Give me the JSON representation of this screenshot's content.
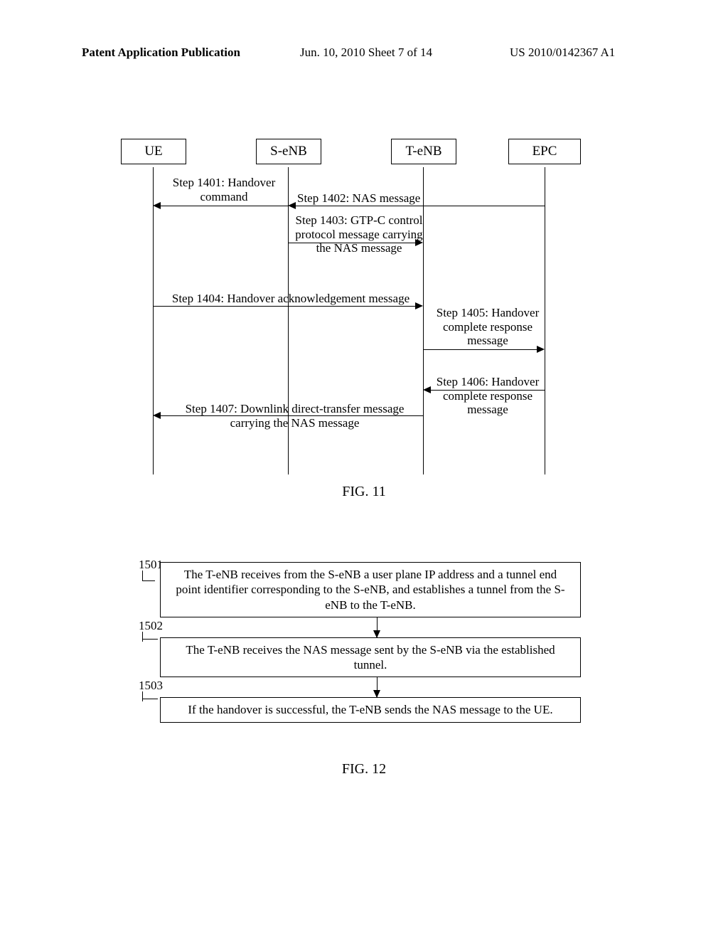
{
  "header": {
    "left": "Patent Application Publication",
    "mid": "Jun. 10, 2010  Sheet 7 of 14",
    "right": "US 2010/0142367 A1"
  },
  "fig11": {
    "actors": {
      "ue": "UE",
      "senb": "S-eNB",
      "tenb": "T-eNB",
      "epc": "EPC"
    },
    "steps": {
      "s1401": "Step 1401: Handover command",
      "s1402": "Step 1402: NAS message",
      "s1403": "Step 1403: GTP-C control protocol message carrying the NAS message",
      "s1404": "Step 1404: Handover acknowledgement message",
      "s1405": "Step 1405: Handover complete response message",
      "s1406": "Step 1406: Handover complete response message",
      "s1407": "Step 1407: Downlink direct-transfer message carrying the NAS message"
    },
    "caption": "FIG. 11"
  },
  "fig12": {
    "boxes": {
      "b1501": {
        "num": "1501",
        "text": "The T-eNB receives from the S-eNB a user plane IP address and a tunnel end point identifier corresponding to the S-eNB, and establishes a tunnel from the S-eNB to the T-eNB."
      },
      "b1502": {
        "num": "1502",
        "text": "The T-eNB receives the NAS message sent by the S-eNB via the established tunnel."
      },
      "b1503": {
        "num": "1503",
        "text": "If the handover is successful, the T-eNB sends the NAS message to the UE."
      }
    },
    "caption": "FIG. 12"
  }
}
